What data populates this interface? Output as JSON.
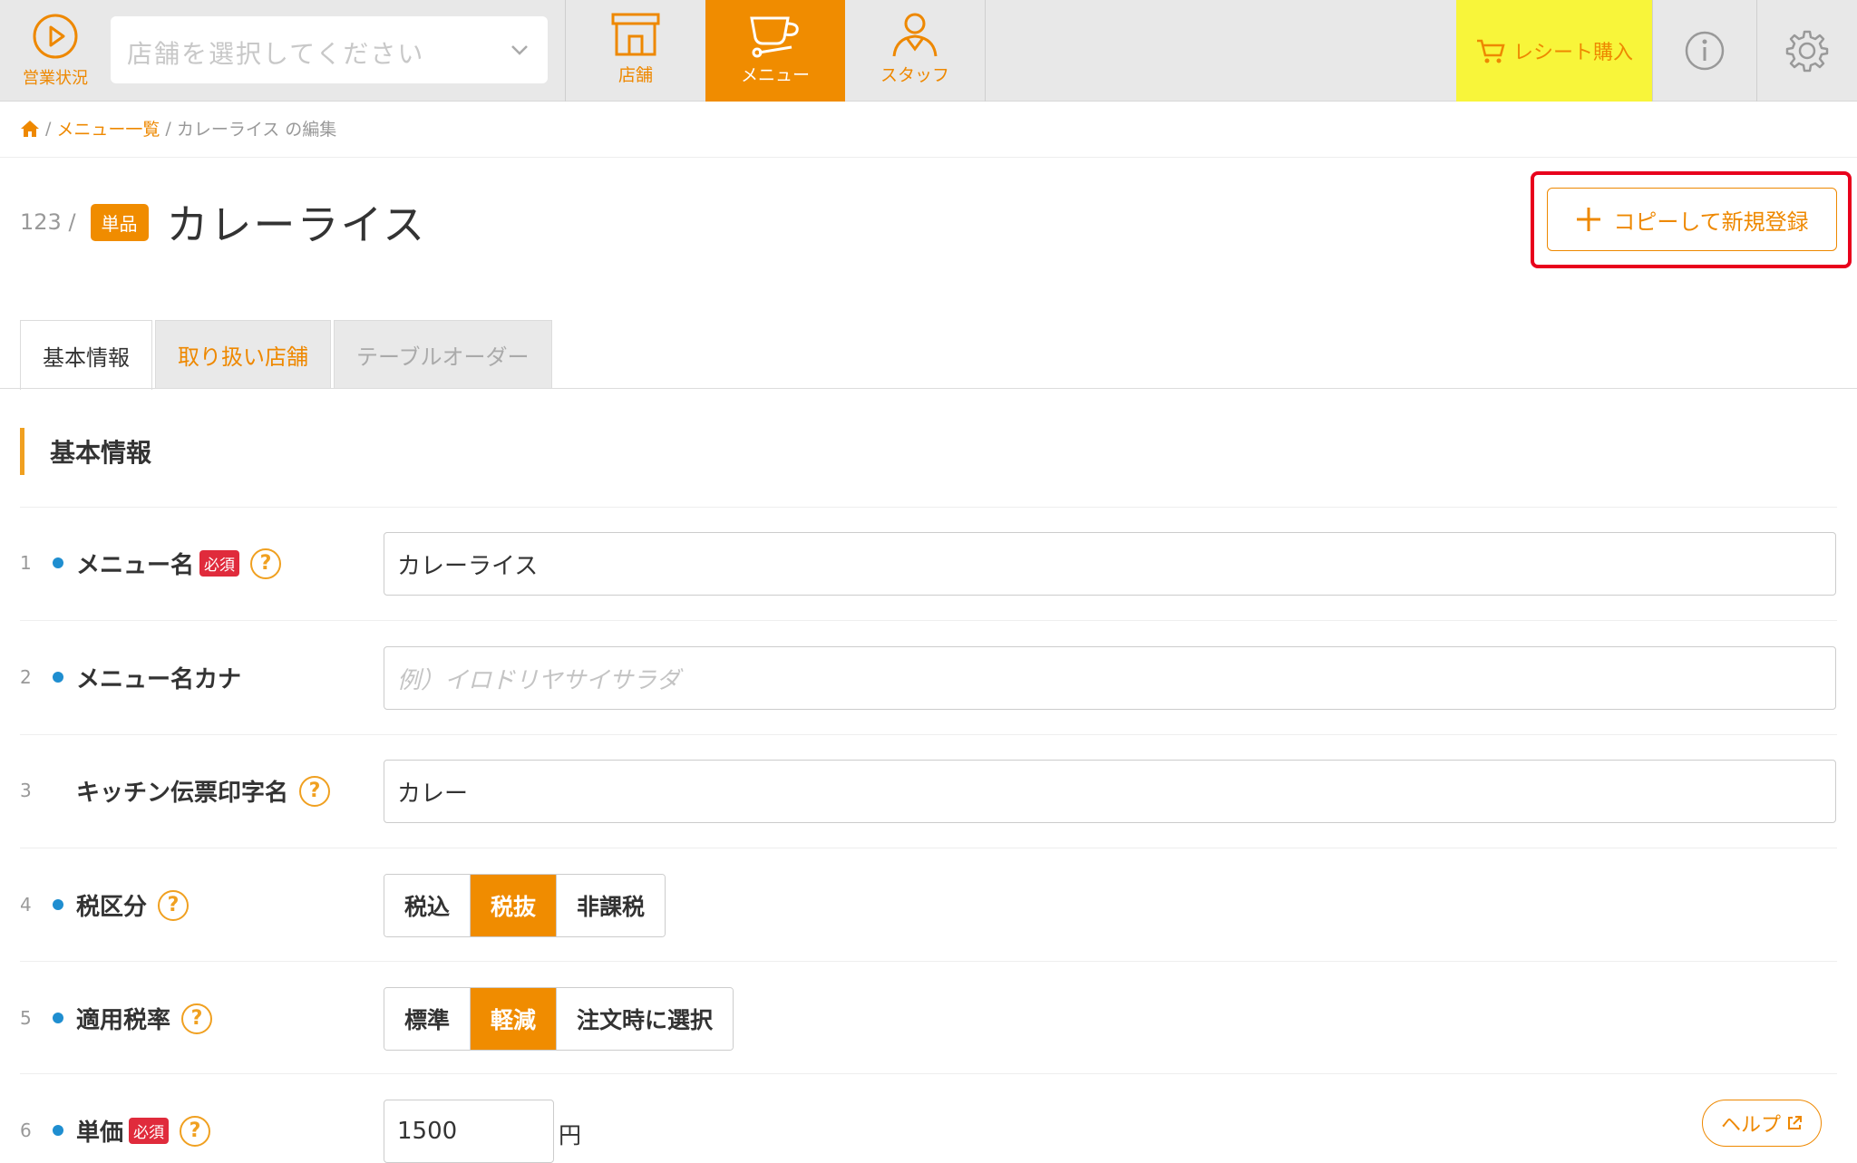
{
  "header": {
    "status_label": "営業状況",
    "store_select_placeholder": "店舗を選択してください",
    "nav": [
      {
        "label": "店舗",
        "icon": "store-icon"
      },
      {
        "label": "メニュー",
        "icon": "cup-icon",
        "active": true
      },
      {
        "label": "スタッフ",
        "icon": "staff-icon"
      }
    ],
    "receipt_label": "レシート購入",
    "accent_color": "#f08c00",
    "receipt_bg": "#f8f53a"
  },
  "breadcrumb": {
    "home_icon": "home-icon",
    "menu_list": "メニュー一覧",
    "current": "カレーライス の編集"
  },
  "title": {
    "id": "123 /",
    "badge": "単品",
    "name": "カレーライス"
  },
  "copy_button": "コピーして新規登録",
  "tabs": [
    "基本情報",
    "取り扱い店舗",
    "テーブルオーダー"
  ],
  "section_title": "基本情報",
  "fields": {
    "menu_name": {
      "num": "1",
      "label": "メニュー名",
      "required": "必須",
      "value": "カレーライス"
    },
    "menu_kana": {
      "num": "2",
      "label": "メニュー名カナ",
      "placeholder": "例）イロドリヤサイサラダ"
    },
    "kitchen_name": {
      "num": "3",
      "label": "キッチン伝票印字名",
      "value": "カレー"
    },
    "tax_type": {
      "num": "4",
      "label": "税区分",
      "options": [
        "税込",
        "税抜",
        "非課税"
      ],
      "selected": "税抜"
    },
    "tax_rate": {
      "num": "5",
      "label": "適用税率",
      "options": [
        "標準",
        "軽減",
        "注文時に選択"
      ],
      "selected": "軽減"
    },
    "price": {
      "num": "6",
      "label": "単価",
      "required": "必須",
      "value": "1500",
      "unit": "円"
    }
  },
  "help_q": "?",
  "help_button": "ヘルプ"
}
